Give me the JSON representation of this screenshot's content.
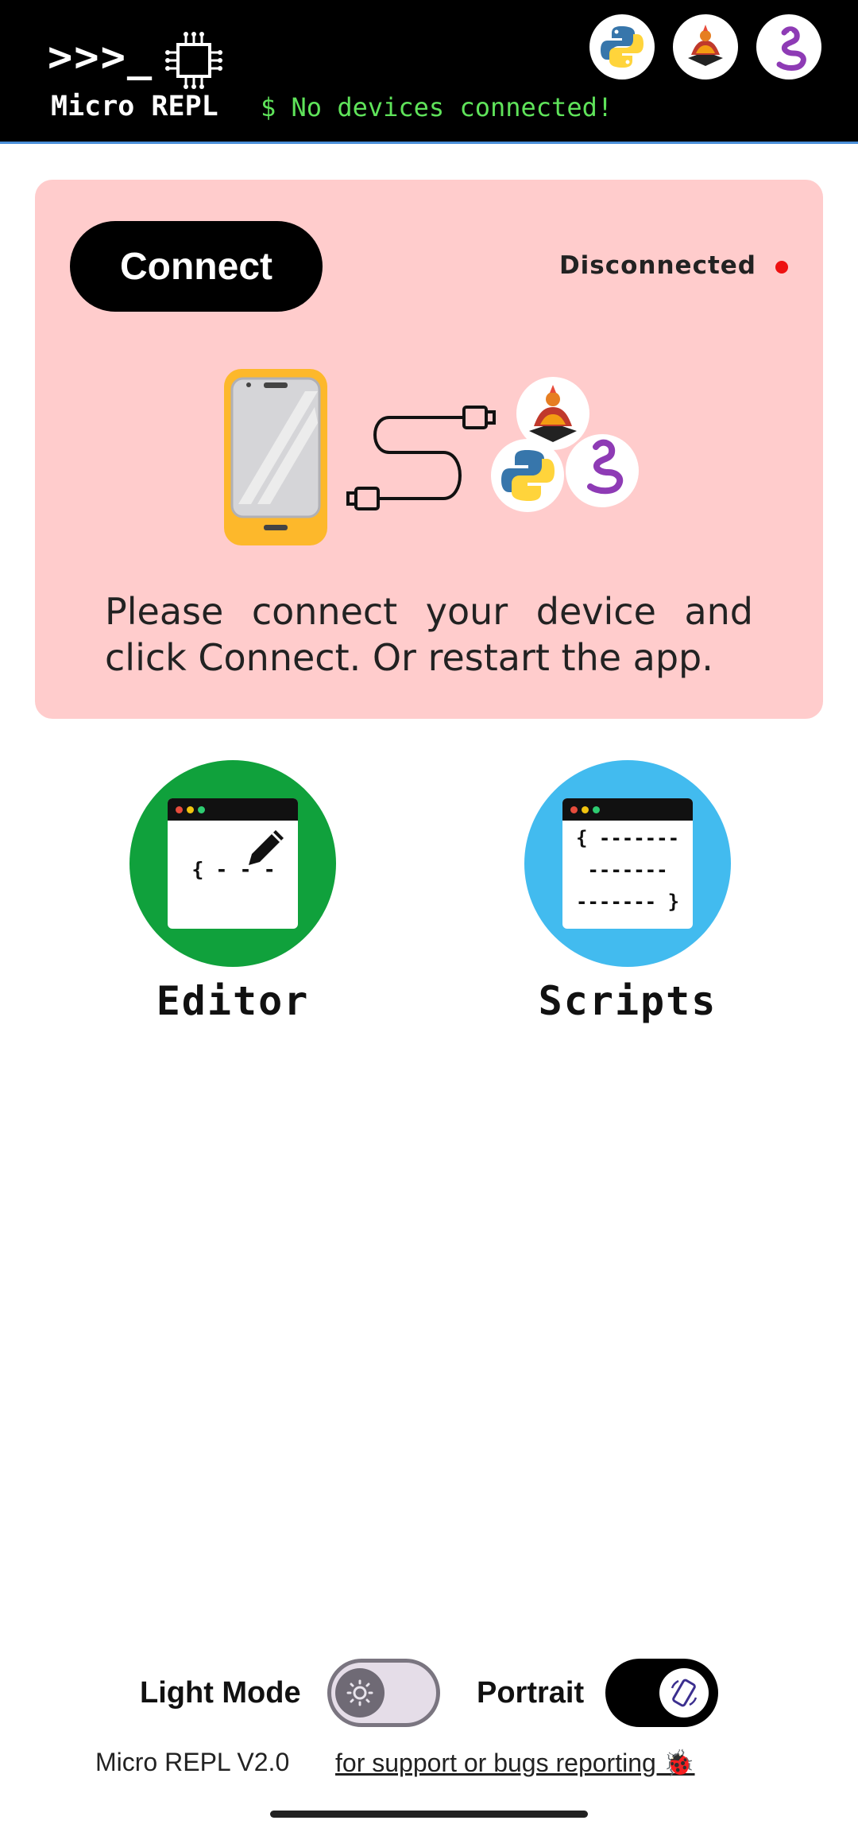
{
  "header": {
    "prompt": ">>>_",
    "app_name": "Micro REPL",
    "status": "$ No devices connected!",
    "badges": [
      "python-logo-icon",
      "micropython-logo-icon",
      "circuitpython-logo-icon"
    ]
  },
  "card": {
    "connect_label": "Connect",
    "status_text": "Disconnected",
    "status_color": "#ee1111",
    "message": "Please connect your device and click Connect. Or restart the app.",
    "background": "#ffcccc"
  },
  "features": {
    "editor": {
      "label": "Editor",
      "color": "#10a13c",
      "content": "{ - - -"
    },
    "scripts": {
      "label": "Scripts",
      "color": "#42bbef",
      "lines": [
        "{ -------",
        "-------",
        "------- }"
      ]
    }
  },
  "footer": {
    "light_mode_label": "Light Mode",
    "light_mode_on": false,
    "portrait_label": "Portrait",
    "portrait_on": true,
    "version": "Micro REPL V2.0",
    "support_link": "for support or bugs reporting 🐞"
  }
}
